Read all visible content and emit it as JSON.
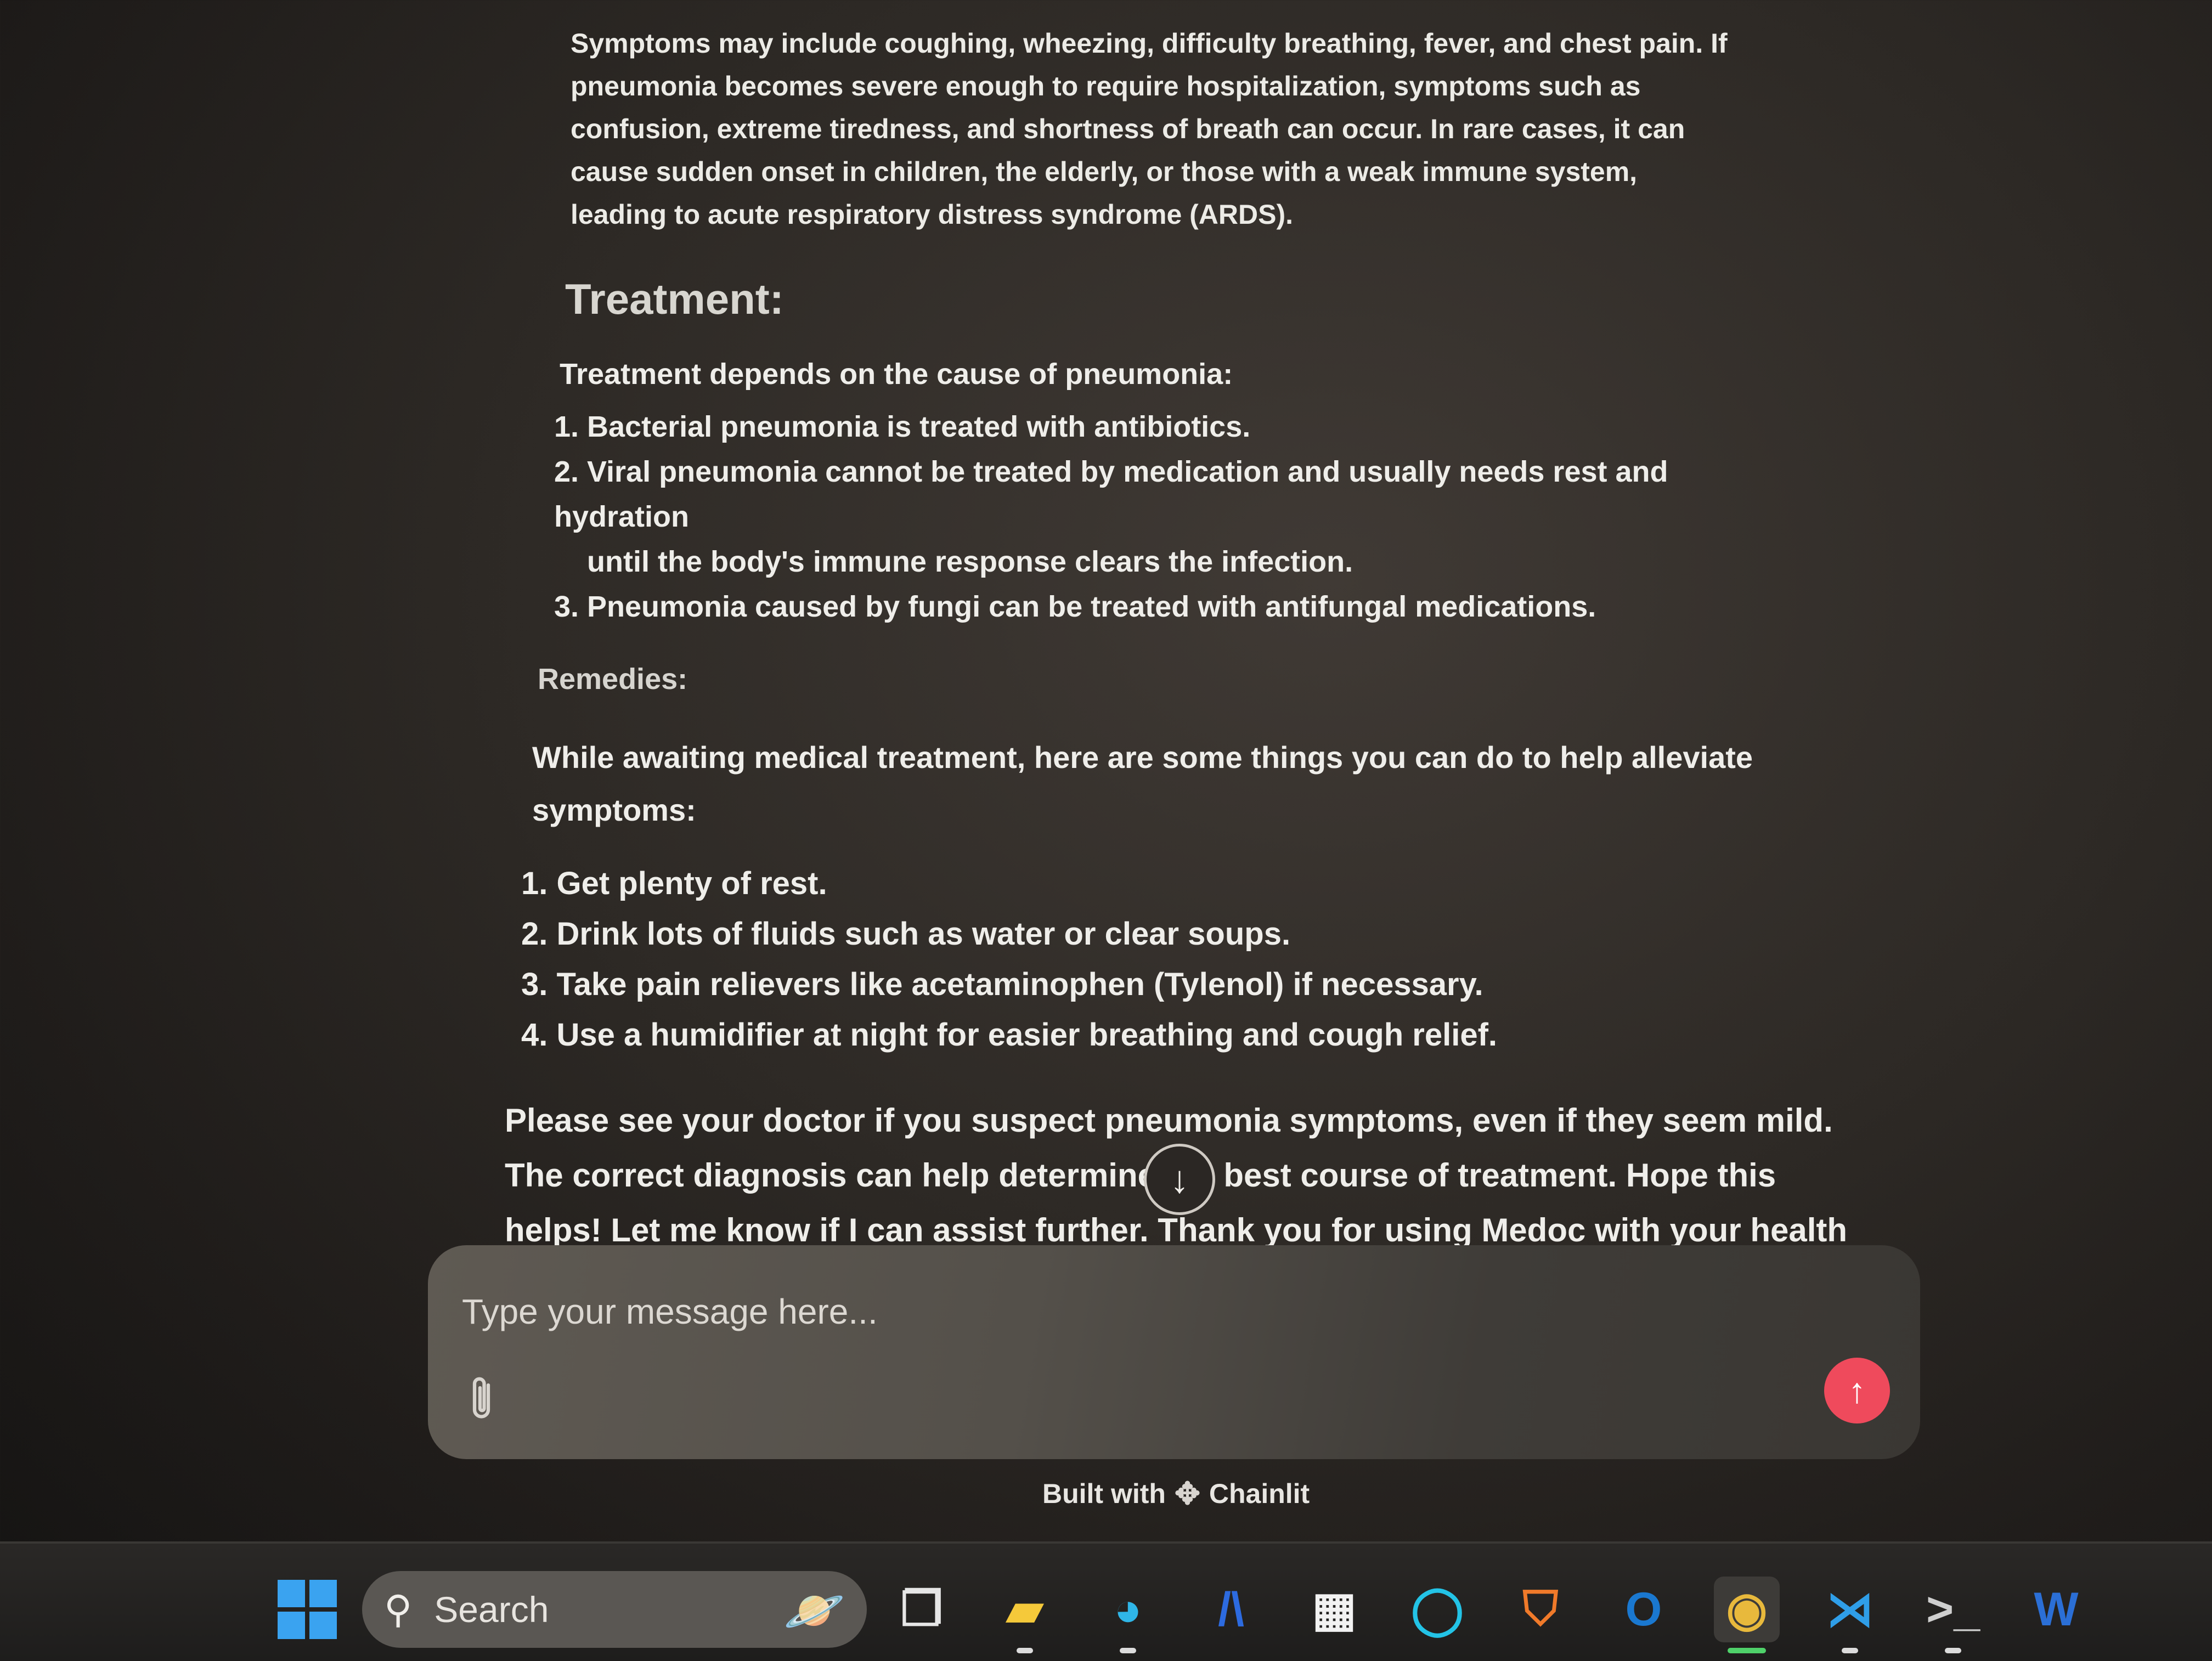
{
  "chat": {
    "symptoms_paragraph": "Symptoms may include coughing, wheezing, difficulty breathing, fever, and chest pain. If pneumonia becomes severe enough to require hospitalization, symptoms such as confusion, extreme tiredness, and shortness of breath can occur. In rare cases, it can cause sudden onset in children, the elderly, or those with a weak immune system, leading to acute respiratory distress syndrome (ARDS).",
    "treatment_heading": "Treatment:",
    "treatment_intro": "Treatment depends on the cause of pneumonia:",
    "treatment_items": [
      {
        "num": "1.",
        "text": "Bacterial pneumonia is treated with antibiotics."
      },
      {
        "num": "2.",
        "text": "Viral pneumonia cannot be treated by medication and usually needs rest and hydration",
        "cont": "until the body's immune response clears the infection."
      },
      {
        "num": "3.",
        "text": "Pneumonia caused by fungi can be treated with antifungal medications."
      }
    ],
    "remedies_heading": "Remedies:",
    "remedies_intro": "While awaiting medical treatment, here are some things you can do to help alleviate symptoms:",
    "remedy_items": [
      {
        "num": "1.",
        "text": "Get plenty of rest."
      },
      {
        "num": "2.",
        "text": "Drink lots of fluids such as water or clear soups."
      },
      {
        "num": "3.",
        "text": "Take pain relievers like acetaminophen (Tylenol) if necessary."
      },
      {
        "num": "4.",
        "text": "Use a humidifier at night for easier breathing and cough relief."
      }
    ],
    "closing_paragraph": "Please see your doctor if you suspect pneumonia symptoms, even if they seem mild. The correct diagnosis can help determine the best course of treatment. Hope this helps! Let me know if I can assist further.  Thank you for using Medoc with your health questions."
  },
  "scroll_button": {
    "icon": "arrow-down-icon",
    "glyph": "↓"
  },
  "composer": {
    "placeholder": "Type your message here...",
    "attach_icon": "paperclip-icon",
    "send_icon": "arrow-up-icon",
    "send_glyph": "↑",
    "send_color": "#ef4a5c"
  },
  "footer": {
    "built_with": "Built with",
    "brand": "Chainlit",
    "logo_glyph": "✥"
  },
  "taskbar": {
    "search_label": "Search",
    "search_glyph": "⚲",
    "apps": [
      {
        "name": "task-view",
        "glyph": "❐",
        "color": "#e6e6e6"
      },
      {
        "name": "file-explorer",
        "glyph": "▰",
        "color": "#f5c93a"
      },
      {
        "name": "edge",
        "glyph": "◕",
        "color": "#2fb6e8"
      },
      {
        "name": "app-blue",
        "glyph": "/\\",
        "color": "#2d6be0"
      },
      {
        "name": "microsoft-store",
        "glyph": "▦",
        "color": "#f2f2f2"
      },
      {
        "name": "cortana",
        "glyph": "◯",
        "color": "#23c3e6"
      },
      {
        "name": "shield-app",
        "glyph": "⛉",
        "color": "#f07a2a"
      },
      {
        "name": "outlook",
        "glyph": "O",
        "color": "#1a78d0"
      },
      {
        "name": "chrome",
        "glyph": "◉",
        "color": "#e8b93c"
      },
      {
        "name": "vscode",
        "glyph": "⋊",
        "color": "#2f9ee8"
      },
      {
        "name": "terminal",
        "glyph": ">_",
        "color": "#cfcfcf"
      },
      {
        "name": "word",
        "glyph": "W",
        "color": "#2b6fd6"
      }
    ]
  }
}
